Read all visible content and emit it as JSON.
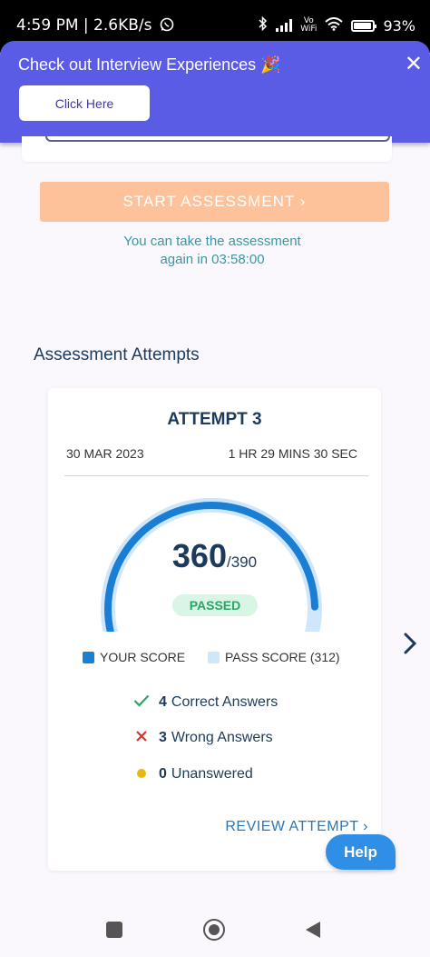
{
  "status_bar": {
    "time_speed": "4:59 PM | 2.6KB/s",
    "vowifi_top": "Vo",
    "vowifi_bottom": "WiFi",
    "battery": "93%"
  },
  "banner": {
    "text": "Check out Interview Experiences 🎉",
    "button_label": "Click Here",
    "close_glyph": "✕"
  },
  "assessment": {
    "start_label": "START ASSESSMENT ›",
    "retake_line1": "You can take the assessment",
    "retake_line2": "again in 03:58:00"
  },
  "attempts_section": {
    "title": "Assessment Attempts",
    "attempt": {
      "title": "ATTEMPT 3",
      "date": "30 MAR 2023",
      "duration": "1 HR 29 MINS 30 SEC",
      "score": "360",
      "total": "/390",
      "score_fraction": 0.923,
      "status": "PASSED",
      "legend_your_score": "YOUR SCORE",
      "legend_pass_score": "PASS SCORE (312)",
      "correct_count": "4",
      "correct_label": "Correct Answers",
      "wrong_count": "3",
      "wrong_label": "Wrong Answers",
      "unanswered_count": "0",
      "unanswered_label": "Unanswered",
      "review_label": "REVIEW ATTEMPT ›"
    }
  },
  "help_label": "Help",
  "icons": {
    "whatsapp": "whatsapp-icon",
    "bluetooth": "bluetooth-icon",
    "wifi": "wifi-icon",
    "next": "chevron-right-icon",
    "check": "check-icon",
    "cross": "cross-icon",
    "dot": "dot-icon"
  },
  "colors": {
    "banner": "#5a5ce6",
    "start_button": "#fdc29a",
    "your_score": "#1a7fd4",
    "pass_score": "#cfe6fb",
    "passed_bg": "#d9f5e4",
    "passed_text": "#2ea36a",
    "correct": "#2ea36a",
    "wrong": "#d9342b",
    "unanswered": "#e8b90c",
    "help": "#2f8fe6"
  }
}
